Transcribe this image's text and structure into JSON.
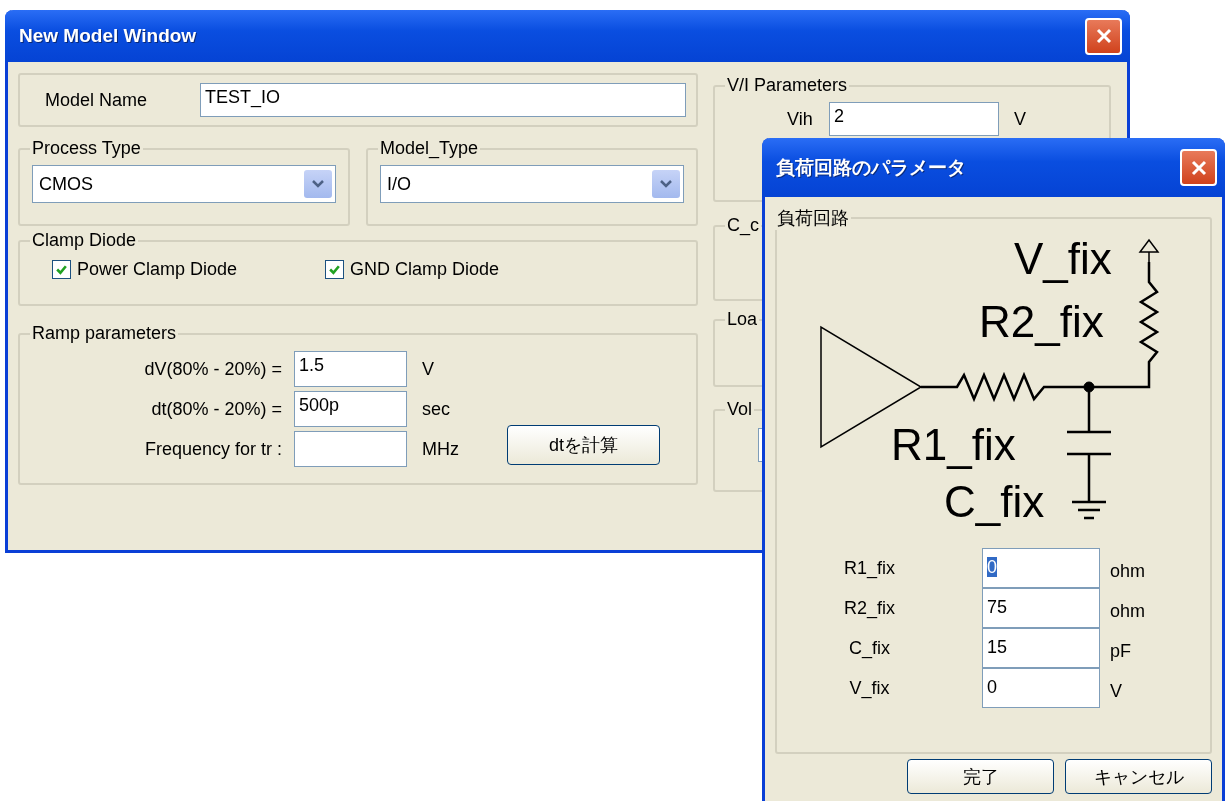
{
  "main_window": {
    "title": "New Model Window",
    "model_name": {
      "label": "Model Name",
      "value": "TEST_IO"
    },
    "process_type": {
      "legend": "Process Type",
      "value": "CMOS"
    },
    "model_type": {
      "legend": "Model_Type",
      "value": "I/O"
    },
    "clamp_diode": {
      "legend": "Clamp Diode",
      "options": [
        {
          "label": "Power Clamp Diode",
          "checked": true
        },
        {
          "label": "GND Clamp Diode",
          "checked": true
        }
      ]
    },
    "ramp": {
      "legend": "Ramp parameters",
      "rows": [
        {
          "label": "dV(80% - 20%) =",
          "value": "1.5",
          "unit": "V"
        },
        {
          "label": "dt(80% - 20%) =",
          "value": "500p",
          "unit": "sec"
        },
        {
          "label": "Frequency for tr :",
          "unit": "MHz"
        }
      ],
      "button": "dtを計算"
    },
    "vi_parameters": {
      "legend": "V/I Parameters",
      "rows": [
        {
          "label": "Vih",
          "value": "2",
          "unit": "V"
        }
      ]
    },
    "groups": [
      {
        "legend": "C_c"
      },
      {
        "legend": "Loa"
      },
      {
        "legend": "Vol"
      }
    ]
  },
  "dialog": {
    "title": "負荷回路のパラメータ",
    "group": "負荷回路",
    "circuit_labels": [
      "V_fix",
      "R2_fix",
      "R1_fix",
      "C_fix"
    ],
    "params": [
      {
        "label": "R1_fix",
        "value": "0",
        "unit": "ohm",
        "selected": true
      },
      {
        "label": "R2_fix",
        "value": "75",
        "unit": "ohm",
        "selected": false
      },
      {
        "label": "C_fix",
        "value": "15",
        "unit": "pF",
        "selected": false
      },
      {
        "label": "V_fix",
        "value": "0",
        "unit": "V",
        "selected": false
      }
    ],
    "buttons": [
      "完了",
      "キャンセル"
    ]
  }
}
